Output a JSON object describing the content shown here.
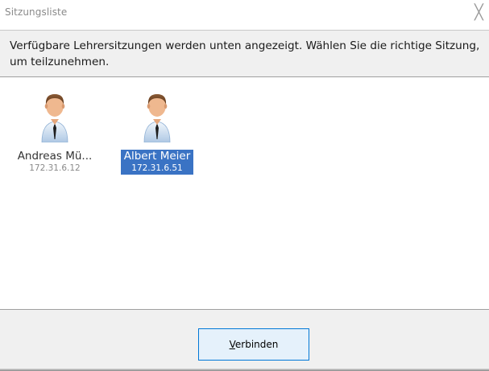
{
  "window": {
    "title": "Sitzungsliste",
    "close_glyph": "╳"
  },
  "instructions": {
    "text": "Verfügbare Lehrersitzungen werden unten angezeigt. Wählen Sie die richtige Sitzung, um teilzunehmen."
  },
  "sessions": [
    {
      "name": "Andreas Mü...",
      "ip": "172.31.6.12",
      "selected": false,
      "icon": "teacher-avatar-icon"
    },
    {
      "name": "Albert Meier",
      "ip": "172.31.6.51",
      "selected": true,
      "icon": "teacher-avatar-icon"
    }
  ],
  "footer": {
    "connect_accel": "V",
    "connect_rest": "erbinden"
  },
  "colors": {
    "selection": "#3a73c4",
    "panel": "#f0f0f0",
    "button_border": "#0078d7",
    "button_fill": "#e5f1fb"
  }
}
